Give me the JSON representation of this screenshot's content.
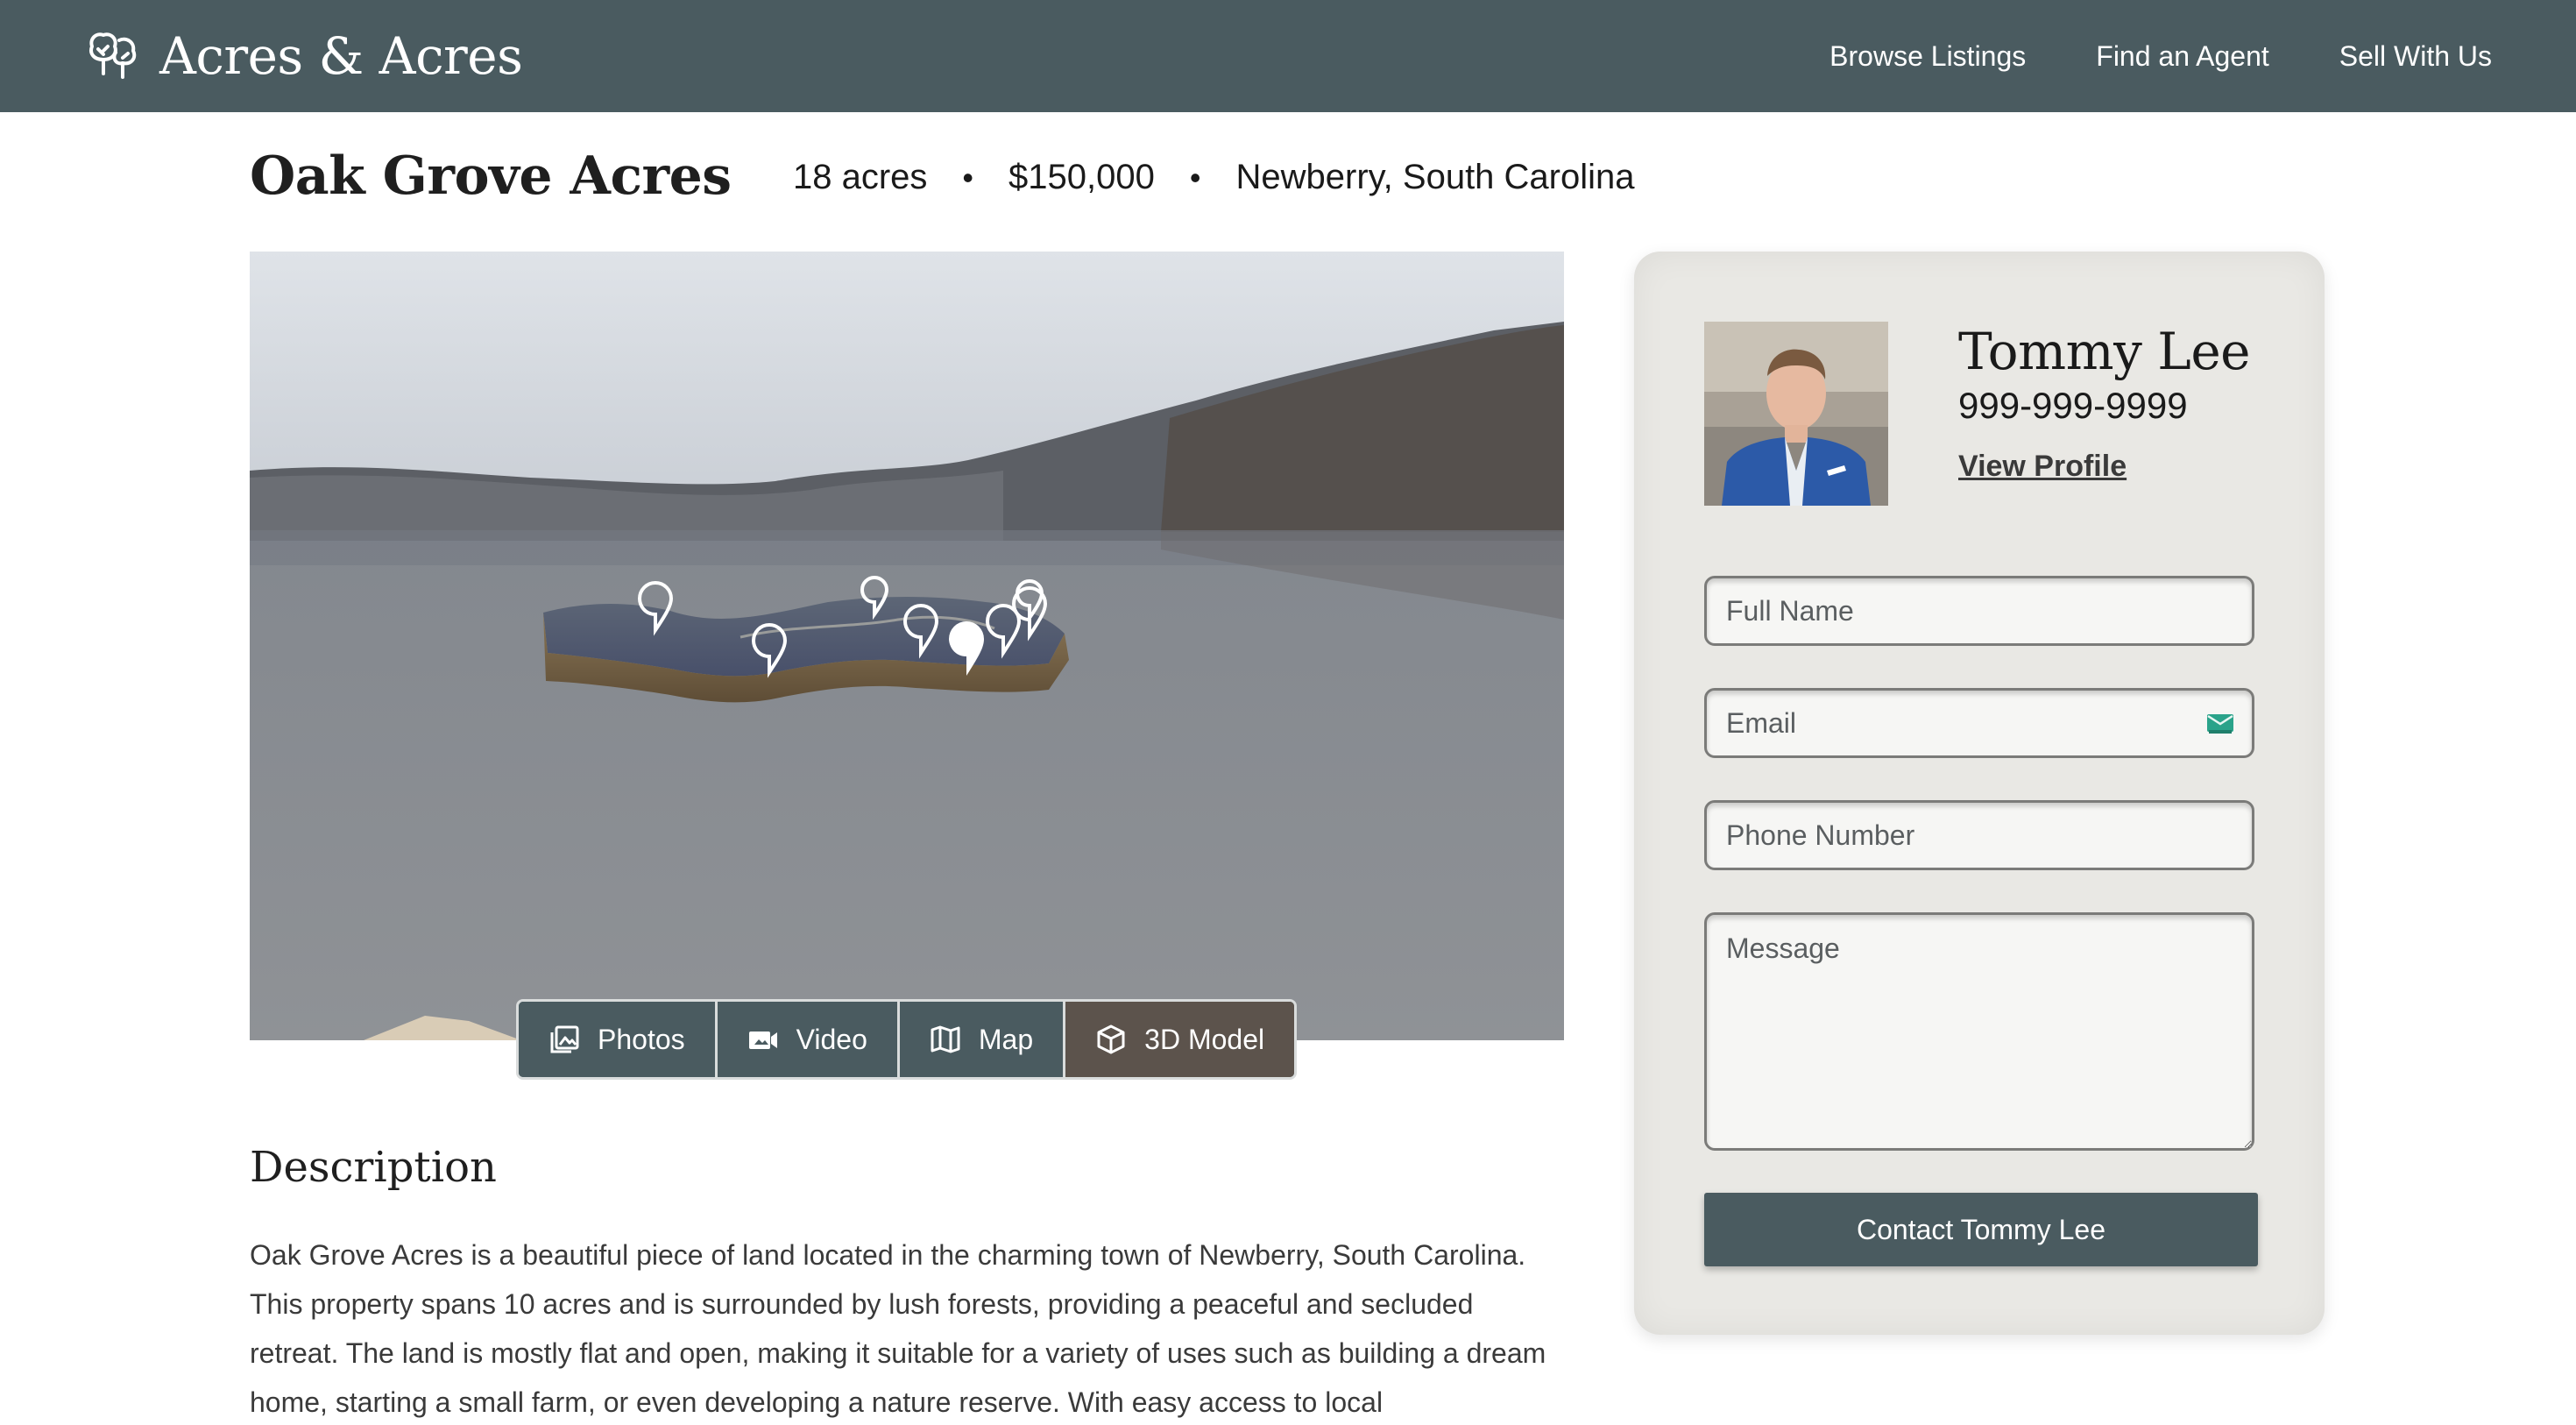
{
  "header": {
    "brand_name": "Acres & Acres",
    "brand_icon": "trees-icon",
    "nav": [
      {
        "label": "Browse Listings"
      },
      {
        "label": "Find an Agent"
      },
      {
        "label": "Sell With Us"
      }
    ]
  },
  "listing": {
    "title": "Oak Grove Acres",
    "acreage": "18 acres",
    "price": "$150,000",
    "location": "Newberry, South Carolina",
    "separator": "•"
  },
  "media_tabs": [
    {
      "label": "Photos",
      "icon": "photos-icon",
      "active": false
    },
    {
      "label": "Video",
      "icon": "video-icon",
      "active": false
    },
    {
      "label": "Map",
      "icon": "map-icon",
      "active": false
    },
    {
      "label": "3D Model",
      "icon": "cube-icon",
      "active": true
    }
  ],
  "description": {
    "heading": "Description",
    "body": "Oak Grove Acres is a beautiful piece of land located in the charming town of Newberry, South Carolina. This property spans 10 acres and is surrounded by lush forests, providing a peaceful and secluded retreat. The land is mostly flat and open, making it suitable for a variety of uses such as building a dream home, starting a small farm, or even developing a nature reserve. With easy access to local"
  },
  "agent": {
    "name": "Tommy Lee",
    "phone": "999-999-9999",
    "profile_link": "View Profile"
  },
  "contact_form": {
    "name_placeholder": "Full Name",
    "email_placeholder": "Email",
    "phone_placeholder": "Phone Number",
    "message_placeholder": "Message",
    "submit_label": "Contact Tommy Lee"
  },
  "colors": {
    "header_bg": "#4a5b60",
    "active_tab_bg": "#5c534c",
    "card_bg": "#e9e8e4",
    "email_icon": "#2aa38a"
  }
}
